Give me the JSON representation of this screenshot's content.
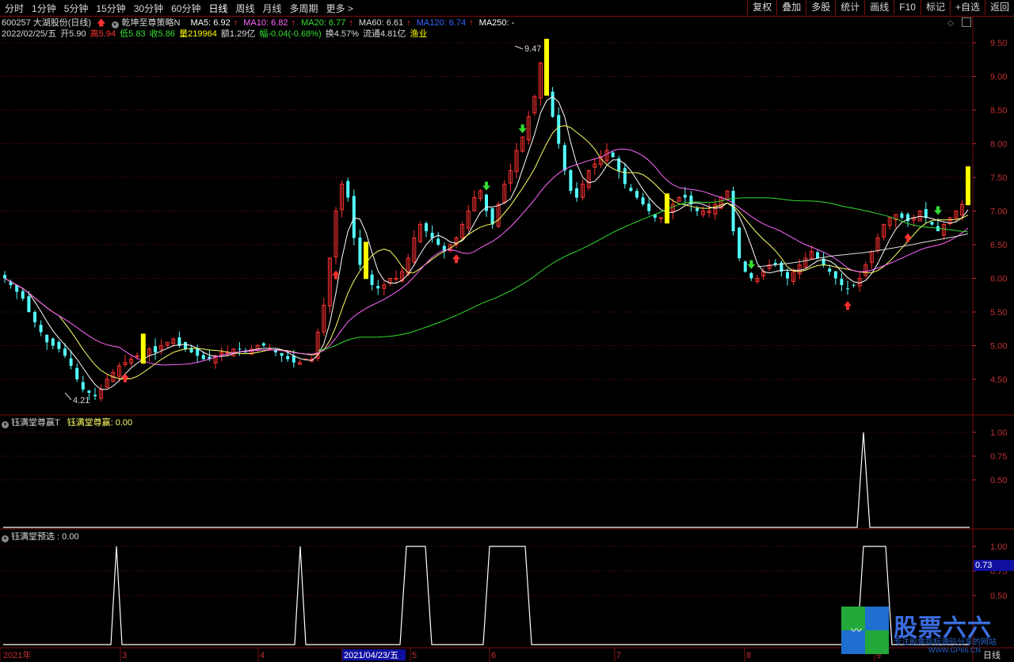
{
  "toolbar": {
    "left": [
      "分时",
      "1分钟",
      "5分钟",
      "15分钟",
      "30分钟",
      "60分钟",
      "日线",
      "周线",
      "月线",
      "多周期",
      "更多 >"
    ],
    "active_index": 6,
    "right": [
      "复权",
      "叠加",
      "多股",
      "统计",
      "画线",
      "F10",
      "标记",
      "+自选",
      "返回"
    ]
  },
  "header": {
    "code_name": "600257 大湖股份(日线)",
    "strategy": "乾坤至尊策略N",
    "ma5": "MA5: 6.92",
    "ma10": "MA10: 6.82",
    "ma20": "MA20: 6.77",
    "ma60": "MA60: 6.61",
    "ma120": "MA120: 6.74",
    "ma250": "MA250: -"
  },
  "quote": {
    "date": "2022/02/25/五",
    "open": "开5.90",
    "high": "高5.94",
    "low": "低5.83",
    "close": "收5.86",
    "volume": "量219964",
    "amount": "额1.29亿",
    "change": "幅-0.04(-0.68%)",
    "turnover": "换4.57%",
    "float": "流通4.81亿",
    "sector": "渔业"
  },
  "main_chart": {
    "price_ticks": [
      "9.50",
      "9.00",
      "8.50",
      "8.00",
      "7.50",
      "7.00",
      "6.50",
      "6.00",
      "5.50",
      "5.00",
      "4.50"
    ],
    "high_label": "9.47",
    "low_label": "4.21"
  },
  "indicator1": {
    "name": "钰满堂尊赢T",
    "value_label": "钰满堂尊赢: 0.00",
    "ticks": [
      "1.00",
      "0.75",
      "0.50"
    ]
  },
  "indicator2": {
    "name": "钰满堂预选 : 0.00",
    "ticks": [
      "1.00",
      "0.75",
      "0.50"
    ],
    "cursor_value": "0.73"
  },
  "time_axis": {
    "labels": [
      "2021年",
      "3",
      "4",
      "2021/04/23/五",
      "5",
      "6",
      "7",
      "8",
      "9"
    ],
    "period": "日线"
  },
  "watermark": {
    "brand": "股票六六",
    "slogan": "专注股票指标源码分享的网站",
    "url": "WWW.GP66.CN"
  },
  "colors": {
    "up": "#ff3232",
    "down": "#54ffff",
    "ma5": "#ffffff",
    "ma10": "#ffff66",
    "ma20": "#ff66ff",
    "ma60": "#33dd33",
    "ma120": "#3366ff",
    "signal_bar": "#ffff00",
    "grid": "#7a1010"
  },
  "chart_data": {
    "type": "candlestick",
    "price_range": [
      4.2,
      9.8
    ],
    "closes": [
      6.0,
      5.9,
      5.8,
      5.7,
      5.5,
      5.35,
      5.2,
      5.05,
      5.0,
      4.95,
      4.85,
      4.7,
      4.5,
      4.35,
      4.3,
      4.25,
      4.35,
      4.5,
      4.6,
      4.7,
      4.75,
      4.8,
      4.85,
      4.9,
      4.95,
      4.9,
      5.0,
      5.05,
      5.1,
      5.0,
      4.95,
      4.9,
      4.85,
      4.8,
      4.8,
      4.85,
      4.9,
      4.9,
      4.95,
      4.95,
      4.9,
      4.95,
      5.0,
      5.0,
      4.95,
      4.9,
      4.85,
      4.8,
      4.75,
      4.75,
      4.8,
      4.8,
      5.2,
      5.6,
      6.3,
      7.0,
      7.4,
      7.2,
      6.6,
      6.2,
      6.0,
      5.9,
      5.85,
      5.9,
      6.0,
      6.0,
      6.1,
      6.3,
      6.6,
      6.8,
      6.7,
      6.6,
      6.5,
      6.4,
      6.5,
      6.6,
      6.8,
      7.0,
      7.2,
      7.3,
      7.0,
      6.8,
      7.1,
      7.4,
      7.6,
      7.9,
      8.1,
      8.4,
      8.7,
      9.2,
      8.8,
      8.4,
      8.0,
      7.6,
      7.3,
      7.2,
      7.4,
      7.6,
      7.7,
      7.8,
      7.9,
      7.8,
      7.6,
      7.4,
      7.3,
      7.2,
      7.1,
      7.0,
      6.9,
      6.9,
      7.0,
      7.1,
      7.2,
      7.2,
      7.1,
      7.0,
      7.0,
      7.0,
      7.1,
      7.2,
      7.3,
      6.7,
      6.3,
      6.1,
      6.0,
      6.0,
      6.1,
      6.2,
      6.2,
      6.1,
      6.0,
      6.1,
      6.2,
      6.3,
      6.4,
      6.3,
      6.2,
      6.1,
      6.0,
      5.9,
      5.85,
      5.9,
      6.0,
      6.2,
      6.4,
      6.6,
      6.8,
      6.9,
      6.95,
      6.9,
      6.85,
      6.9,
      7.0,
      6.9,
      6.8,
      6.7,
      6.8,
      6.9,
      7.0,
      7.1,
      7.3
    ]
  }
}
